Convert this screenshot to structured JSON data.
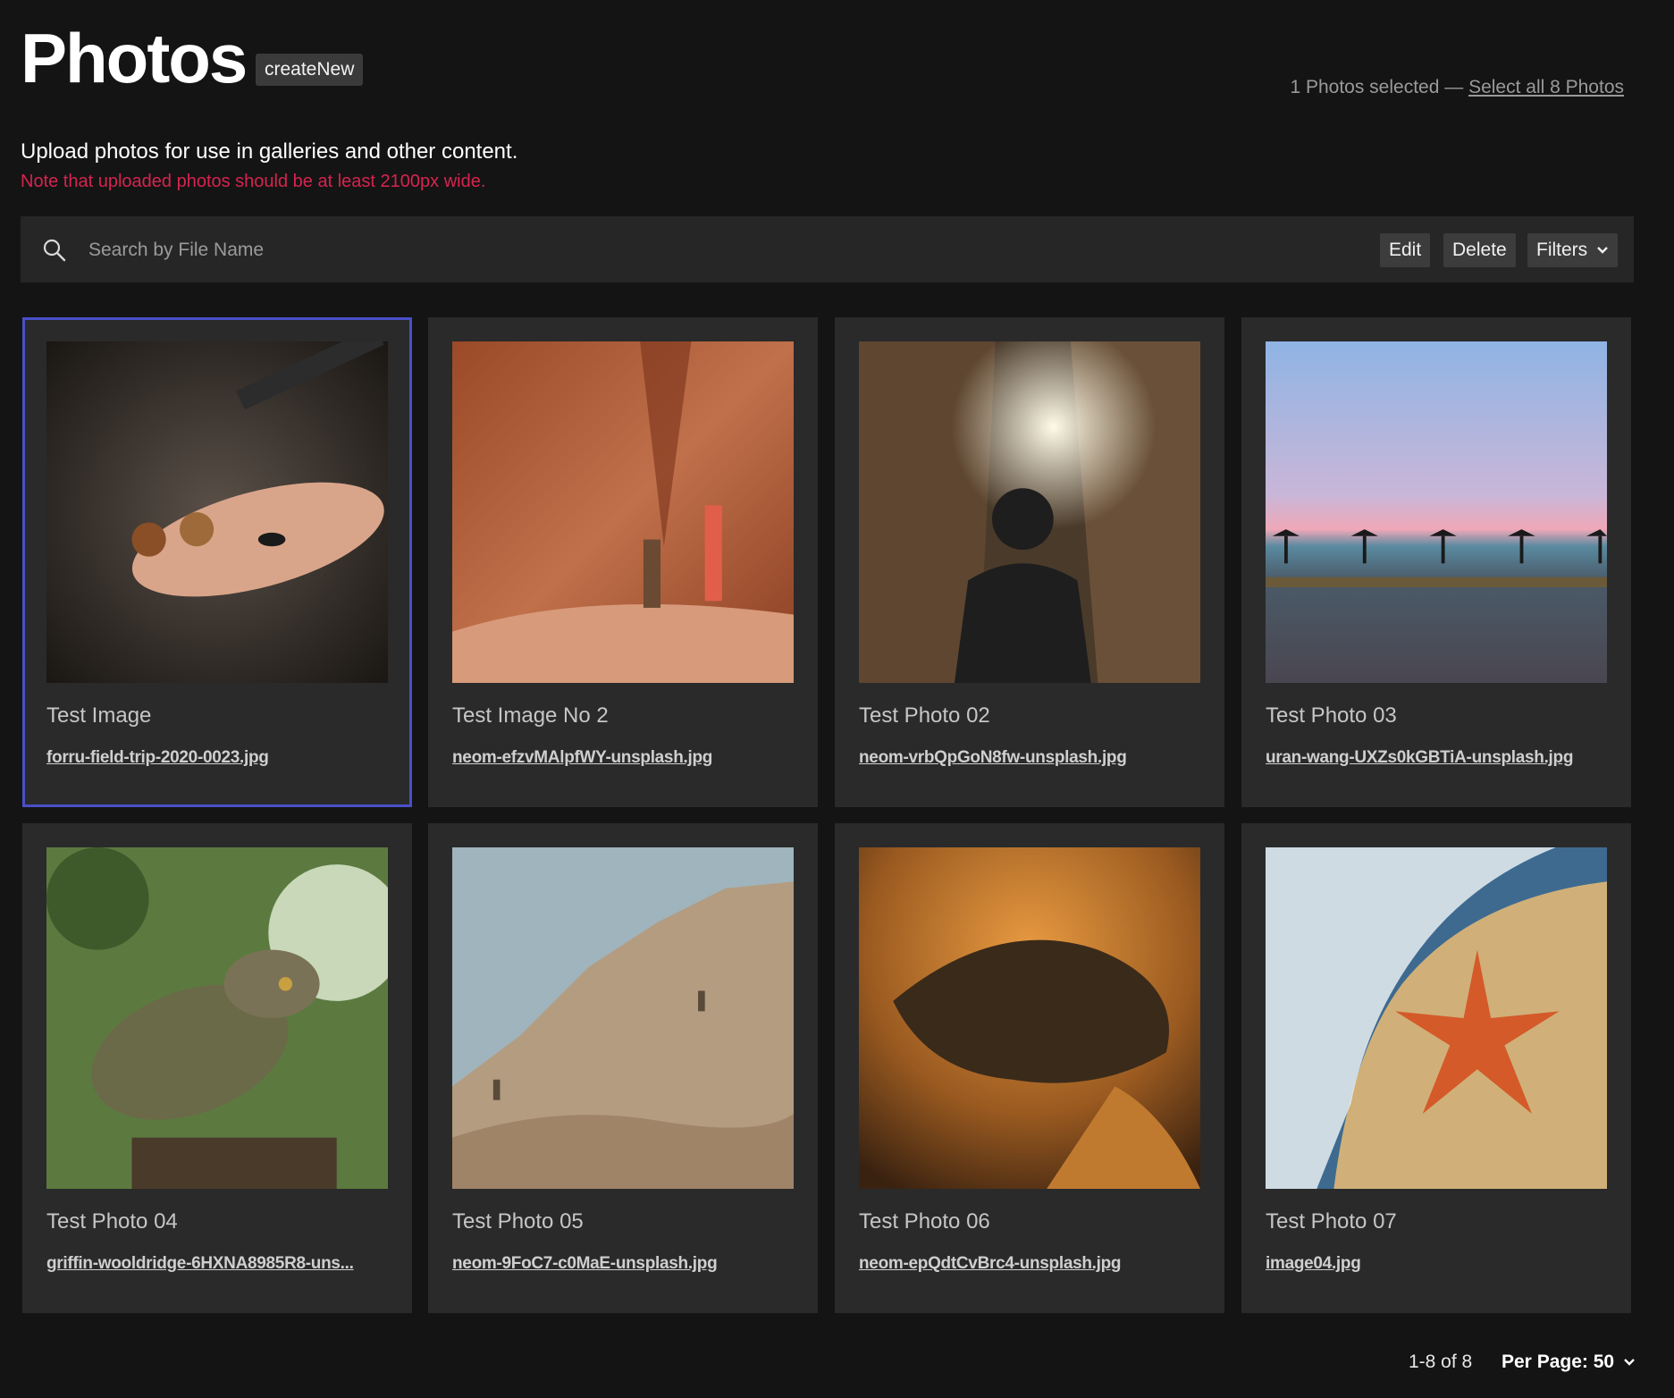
{
  "header": {
    "title": "Photos",
    "create_label": "createNew",
    "selection_count": "1 Photos selected —",
    "select_all_label": "Select all 8 Photos"
  },
  "intro": {
    "description": "Upload photos for use in galleries and other content.",
    "note": "Note that uploaded photos should be at least 2100px wide."
  },
  "toolbar": {
    "search_placeholder": "Search by File Name",
    "search_value": "",
    "edit_label": "Edit",
    "delete_label": "Delete",
    "filters_label": "Filters"
  },
  "photos": [
    {
      "title": "Test Image",
      "filename": "forru-field-trip-2020-0023.jpg",
      "selected": true
    },
    {
      "title": "Test Image No 2",
      "filename": "neom-efzvMAlpfWY-unsplash.jpg",
      "selected": false
    },
    {
      "title": "Test Photo 02",
      "filename": "neom-vrbQpGoN8fw-unsplash.jpg",
      "selected": false
    },
    {
      "title": "Test Photo 03",
      "filename": "uran-wang-UXZs0kGBTiA-unsplash.jpg",
      "selected": false
    },
    {
      "title": "Test Photo 04",
      "filename": "griffin-wooldridge-6HXNA8985R8-uns...",
      "selected": false
    },
    {
      "title": "Test Photo 05",
      "filename": "neom-9FoC7-c0MaE-unsplash.jpg",
      "selected": false
    },
    {
      "title": "Test Photo 06",
      "filename": "neom-epQdtCvBrc4-unsplash.jpg",
      "selected": false
    },
    {
      "title": "Test Photo 07",
      "filename": "image04.jpg",
      "selected": false
    }
  ],
  "pagination": {
    "range_label": "1-8 of 8",
    "per_page_label": "Per Page: 50"
  },
  "colors": {
    "background": "#141414",
    "card": "#2a2a2a",
    "selected_border": "#4a4fc9",
    "note": "#d6244f"
  }
}
